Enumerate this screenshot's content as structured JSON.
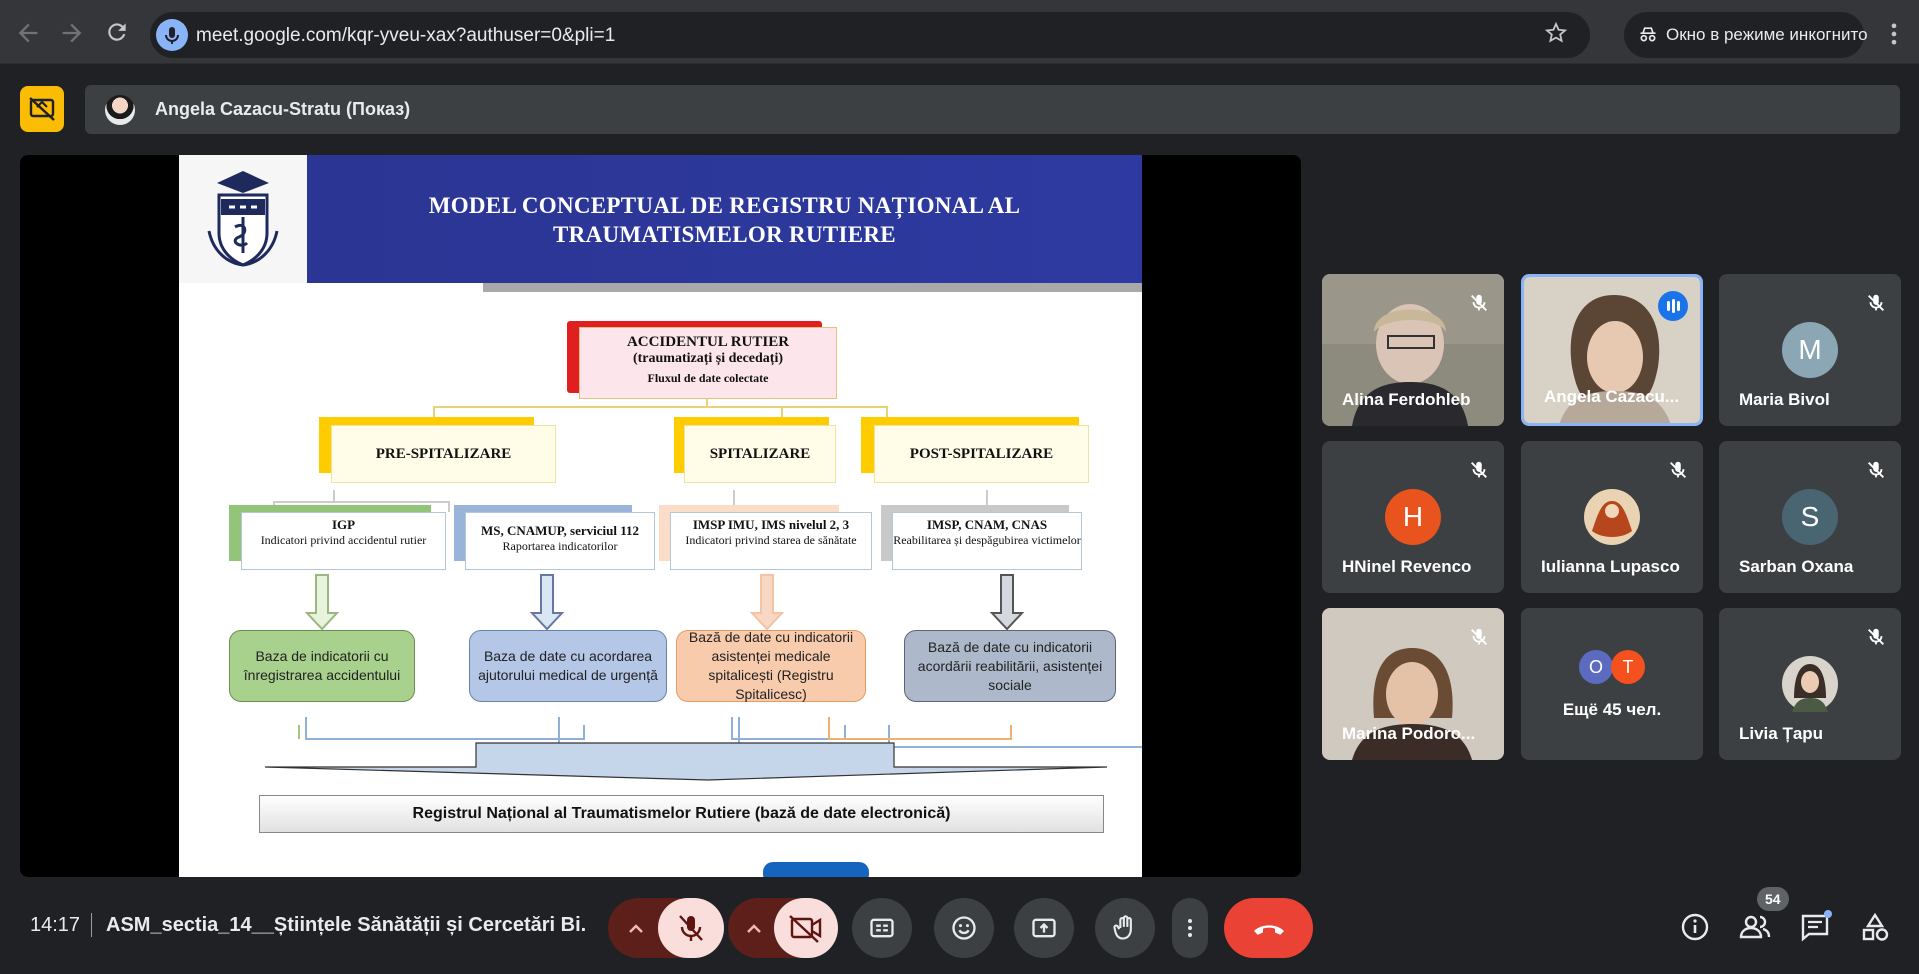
{
  "browser": {
    "url": "meet.google.com/kqr-yveu-xax?authuser=0&pli=1",
    "incognito_label": "Окно в режиме инкогнито"
  },
  "presenter": {
    "name": "Angela Cazacu-Stratu (Показ)"
  },
  "slide": {
    "title_line1": "MODEL CONCEPTUAL DE  REGISTRU NAȚIONAL AL",
    "title_line2": "TRAUMATISMELOR RUTIERE",
    "top_box": {
      "line1": "ACCIDENTUL RUTIER",
      "line2": "(traumatizați și decedați)",
      "line3": "Fluxul de date colectate"
    },
    "phases": [
      "PRE-SPITALIZARE",
      "SPITALIZARE",
      "POST-SPITALIZARE"
    ],
    "sources": [
      {
        "title": "IGP",
        "text": "Indicatori privind accidentul rutier"
      },
      {
        "title": "MS, CNAMUP, serviciul 112",
        "text": "Raportarea indicatorilor"
      },
      {
        "title": "IMSP IMU, IMS nivelul 2, 3",
        "text": "Indicatori privind starea de sănătate"
      },
      {
        "title": "IMSP, CNAM, CNAS",
        "text": "Reabilitarea și despăgubirea victimelor"
      }
    ],
    "databases": [
      "Baza de indicatorii cu înregistrarea accidentului",
      "Baza de date cu acordarea ajutorului medical de urgență",
      "Bază de date cu indicatorii asistenței medicale spitalicești (Registru Spitalicesc)",
      "Bază de date cu indicatorii acordării reabilitării, asistenței sociale"
    ],
    "registry": "Registrul Național al Traumatismelor Rutiere (bază de date electronică)"
  },
  "participants": [
    {
      "name": "Alina Ferdohleb",
      "muted": true,
      "type": "video"
    },
    {
      "name": "Angela Cazacu...",
      "muted": false,
      "type": "video",
      "speaking": true
    },
    {
      "name": "Maria Bivol",
      "muted": true,
      "initial": "M",
      "color": "#8ba6b4"
    },
    {
      "name": "HNinel Revenco",
      "muted": true,
      "initial": "H",
      "color": "#e8531e"
    },
    {
      "name": "Iulianna Lupasco",
      "muted": true,
      "type": "photo"
    },
    {
      "name": "Sarban Oxana",
      "muted": true,
      "initial": "S",
      "color": "#4a6572"
    },
    {
      "name": "Marina Podoro...",
      "muted": true,
      "type": "video"
    },
    {
      "name": "Ещё 45 чел.",
      "muted": false,
      "initials": [
        "O",
        "T"
      ]
    },
    {
      "name": "Livia Țapu",
      "muted": true,
      "type": "photo"
    }
  ],
  "bottom": {
    "time": "14:17",
    "meeting_name": "ASM_sectia_14__Științele Sănătății și Cercetări Bi...",
    "people_count": "54"
  },
  "colors": {
    "accent_yellow": "#fbbc04",
    "end_call": "#ea4335",
    "muted_red": "#f9dedc"
  }
}
